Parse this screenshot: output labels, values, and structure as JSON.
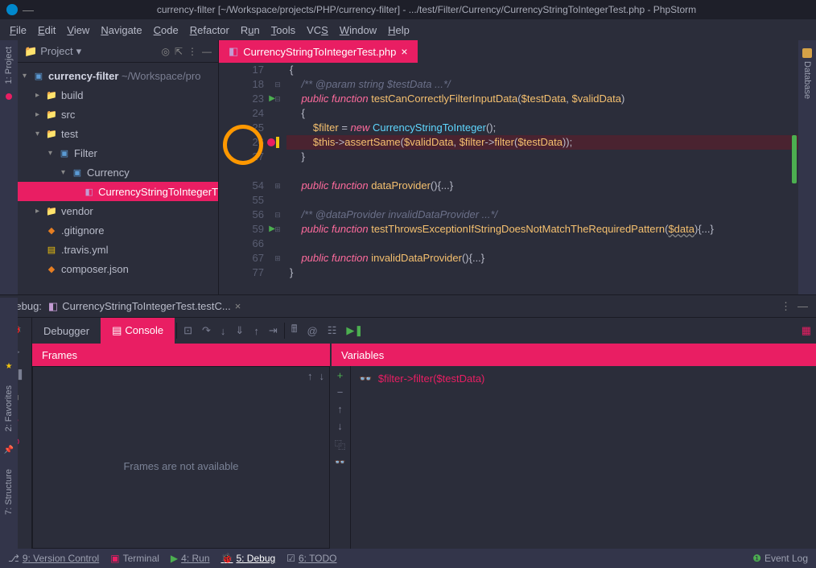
{
  "window": {
    "title": "currency-filter [~/Workspace/projects/PHP/currency-filter] - .../test/Filter/Currency/CurrencyStringToIntegerTest.php - PhpStorm"
  },
  "menu": {
    "file": "File",
    "edit": "Edit",
    "view": "View",
    "navigate": "Navigate",
    "code": "Code",
    "refactor": "Refactor",
    "run": "Run",
    "tools": "Tools",
    "vcs": "VCS",
    "window": "Window",
    "help": "Help"
  },
  "project": {
    "label": "Project",
    "root": "currency-filter",
    "rootPath": "~/Workspace/pro",
    "items": {
      "build": "build",
      "src": "src",
      "test": "test",
      "filter": "Filter",
      "currency": "Currency",
      "testfile": "CurrencyStringToIntegerT",
      "vendor": "vendor",
      "gitignore": ".gitignore",
      "travis": ".travis.yml",
      "composer": "composer.json"
    }
  },
  "editor": {
    "tabName": "CurrencyStringToIntegerTest.php",
    "lines": {
      "l17": "17",
      "l18": "18",
      "l23": "23",
      "l24": "24",
      "l25": "25",
      "l26": "26",
      "l27": "27",
      "l54": "54",
      "l55": "55",
      "l56": "56",
      "l59": "59",
      "l66": "66",
      "l67": "67",
      "l77": "77"
    }
  },
  "debug": {
    "label": "Debug:",
    "tabName": "CurrencyStringToIntegerTest.testC...",
    "debugger": "Debugger",
    "console": "Console",
    "frames": "Frames",
    "variables": "Variables",
    "framesEmpty": "Frames are not available",
    "watchExpr": "$filter->filter($testData)"
  },
  "sidebar": {
    "project": "1: Project",
    "favorites": "2: Favorites",
    "structure": "7: Structure",
    "database": "Database"
  },
  "statusbar": {
    "vcs": "9: Version Control",
    "terminal": "Terminal",
    "run": "4: Run",
    "debug": "5: Debug",
    "todo": "6: TODO",
    "eventlog": "Event Log"
  }
}
